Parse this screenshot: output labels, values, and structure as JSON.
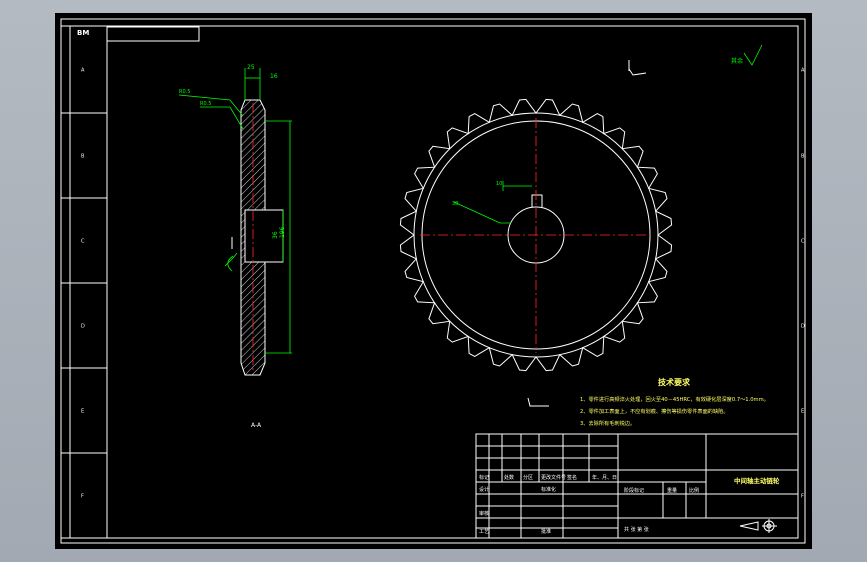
{
  "drawing": {
    "background_color": "#000000",
    "outline_color": "#ffffff",
    "dimension_color": "#00ff00",
    "centerline_color": "#ff2a2a",
    "note_color": "#ffff66",
    "corner_tag": "BM",
    "view_label": "A-A",
    "zone_letters": [
      "A",
      "B",
      "C",
      "D",
      "E",
      "F"
    ],
    "surface_symbol": "其余"
  },
  "tech_requirements": {
    "title": "技术要求",
    "items": [
      "1、零件进行高频淬火处理，回火至40－45HRC，有效硬化层深度0.7～1.0mm。",
      "2、零件加工表面上，不应有划痕、擦伤等损伤零件表面的缺陷。",
      "3、去除所有毛刺锐边。"
    ]
  },
  "title_block": {
    "part_name": "中间轴主动链轮",
    "row_labels": [
      "标记",
      "处数",
      "分区",
      "更改文件号",
      "签名",
      "年、月、日"
    ],
    "design": "设计",
    "standard": "标准化",
    "review": "审核",
    "process": "工艺",
    "approve": "批准",
    "stage": "阶段标记",
    "weight": "重量",
    "scale": "比例",
    "sheet": "共  张  第  张"
  },
  "dimensions": {
    "side_top": "25",
    "side_top2": "16",
    "side_left": "R0.5",
    "side_left2": "R0.5",
    "hub_label": "36",
    "overall_label": "196",
    "keyway_label": "10",
    "bore_leader": "38"
  },
  "sprocket": {
    "teeth": 32
  }
}
